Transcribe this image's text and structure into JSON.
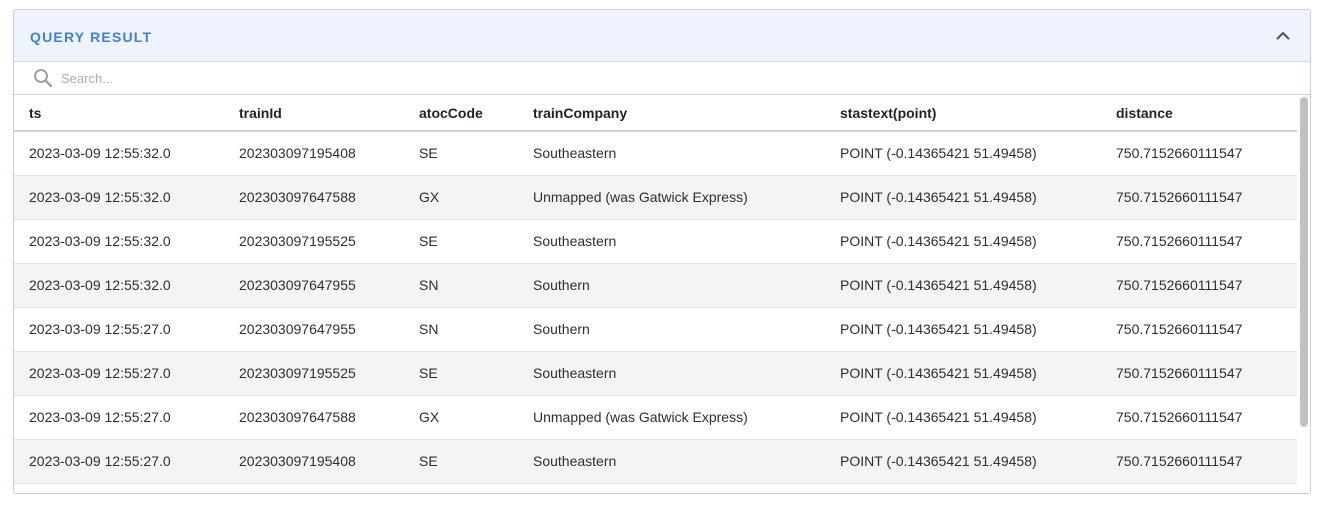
{
  "panel": {
    "title": "QUERY RESULT"
  },
  "search": {
    "placeholder": "Search...",
    "value": ""
  },
  "table": {
    "columns": [
      "ts",
      "trainId",
      "atocCode",
      "trainCompany",
      "stastext(point)",
      "distance"
    ],
    "rows": [
      [
        "2023-03-09 12:55:32.0",
        "202303097195408",
        "SE",
        "Southeastern",
        "POINT (-0.14365421 51.49458)",
        "750.7152660111547"
      ],
      [
        "2023-03-09 12:55:32.0",
        "202303097647588",
        "GX",
        "Unmapped (was Gatwick Express)",
        "POINT (-0.14365421 51.49458)",
        "750.7152660111547"
      ],
      [
        "2023-03-09 12:55:32.0",
        "202303097195525",
        "SE",
        "Southeastern",
        "POINT (-0.14365421 51.49458)",
        "750.7152660111547"
      ],
      [
        "2023-03-09 12:55:32.0",
        "202303097647955",
        "SN",
        "Southern",
        "POINT (-0.14365421 51.49458)",
        "750.7152660111547"
      ],
      [
        "2023-03-09 12:55:27.0",
        "202303097647955",
        "SN",
        "Southern",
        "POINT (-0.14365421 51.49458)",
        "750.7152660111547"
      ],
      [
        "2023-03-09 12:55:27.0",
        "202303097195525",
        "SE",
        "Southeastern",
        "POINT (-0.14365421 51.49458)",
        "750.7152660111547"
      ],
      [
        "2023-03-09 12:55:27.0",
        "202303097647588",
        "GX",
        "Unmapped (was Gatwick Express)",
        "POINT (-0.14365421 51.49458)",
        "750.7152660111547"
      ],
      [
        "2023-03-09 12:55:27.0",
        "202303097195408",
        "SE",
        "Southeastern",
        "POINT (-0.14365421 51.49458)",
        "750.7152660111547"
      ]
    ]
  },
  "icons": {
    "collapse": "chevron-up-icon",
    "search": "search-icon"
  },
  "colors": {
    "accent": "#3d7fd9",
    "header_bg": "#eef3fd",
    "stripe": "#f4f4f4"
  }
}
